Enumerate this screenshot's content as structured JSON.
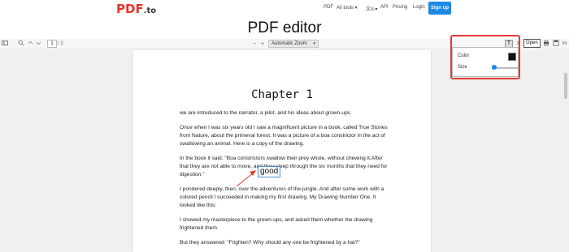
{
  "header": {
    "logo_main": "PDF",
    "logo_tld": ".to",
    "nav": {
      "pdf": "PDF",
      "all_tools": "All tools ▾",
      "lang": "文A ▾",
      "api": "API",
      "pricing": "Pricing",
      "login": "Login"
    },
    "signup": "Sign up"
  },
  "page_title": "PDF editor",
  "toolbar": {
    "page_number": "1",
    "page_total": "/ 2",
    "zoom_minus": "−",
    "zoom_plus": "+",
    "zoom": "Automatic Zoom",
    "text_tool": "T",
    "open": "Open"
  },
  "document": {
    "chapter": "Chapter 1",
    "paragraphs": [
      "we are introduced to the narrator, a pilot, and his ideas about grown-ups",
      "Once when I was six years old I saw a magnificent picture in a book, called True Stories from Nature, about the primeval forest. It was a picture of a boa constrictor in the act of swallowing an animal. Here is a copy of the drawing.",
      "In the book it said: \"Boa constrictors swallow their prey whole, without chewing it.After that they are not able to move, and they sleep through the six months that they need for digestion.\"",
      "I pondered deeply, then, over the adventures of the jungle. And after some work with a colored pencil I succeeded in making my first drawing. My Drawing Number One. It looked like this:",
      "I showed my masterpiece to the grown-ups, and asked them whether the drawing frightened them.",
      "But they answered: \"Frighten? Why should any one be frightened by a hat?\""
    ],
    "annotation": "good"
  },
  "text_popup": {
    "color_label": "Color",
    "color_value": "#111111",
    "size_label": "Size",
    "size_level": 0.1
  },
  "colors": {
    "brand": "#e8322b",
    "accent": "#1e88e5",
    "highlight": "#e53935"
  }
}
